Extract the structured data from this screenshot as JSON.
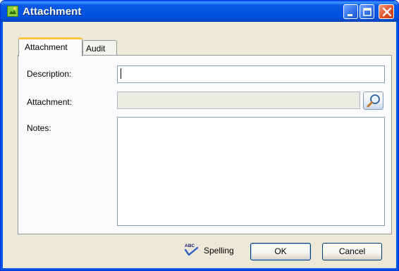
{
  "window": {
    "title": "Attachment",
    "title_icon": "app-icon",
    "controls": [
      "minimize-icon",
      "maximize-icon",
      "close-icon"
    ]
  },
  "tabs": [
    {
      "label": "Attachment",
      "active": true
    },
    {
      "label": "Audit",
      "active": false
    }
  ],
  "form": {
    "description_label": "Description:",
    "description_value": "",
    "attachment_label": "Attachment:",
    "attachment_value": "",
    "browse_icon": "magnifier-icon",
    "notes_label": "Notes:",
    "notes_value": ""
  },
  "footer": {
    "spelling_label": "Spelling",
    "spelling_icon": "spell-check-icon",
    "ok_label": "OK",
    "cancel_label": "Cancel"
  },
  "colors": {
    "titlebar": "#0054e3",
    "dialog_bg": "#ece9d8",
    "active_tab_accent": "#ffc73c",
    "close_button": "#e0542a"
  }
}
